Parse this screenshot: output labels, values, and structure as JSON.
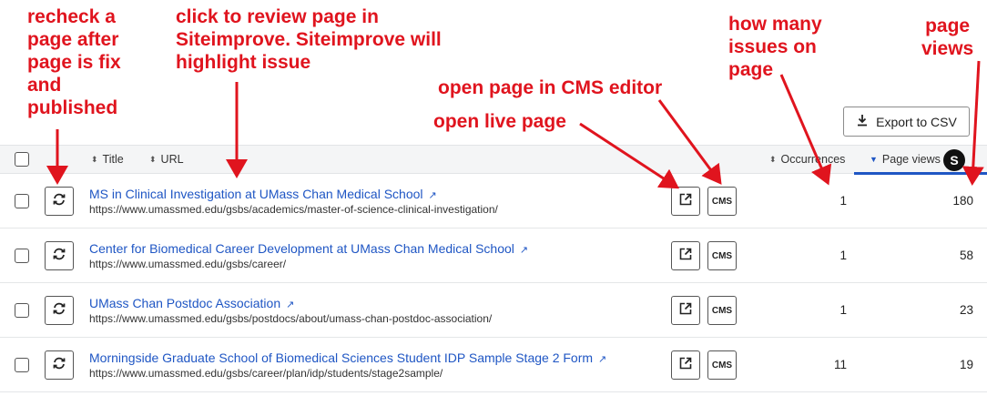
{
  "annotations": {
    "recheck": [
      "recheck a",
      "page after",
      "page is fix",
      "and",
      "published"
    ],
    "review": [
      "click to review page in",
      "Siteimprove. Siteimprove will",
      "highlight issue"
    ],
    "cms": "open page in CMS editor",
    "live": "open live page",
    "issues": [
      "how many",
      "issues on",
      "page"
    ],
    "views": [
      "page",
      "views"
    ]
  },
  "toolbar": {
    "export_label": "Export to CSV"
  },
  "table": {
    "headers": {
      "title": "Title",
      "url": "URL",
      "occurrences": "Occurrences",
      "page_views": "Page views"
    },
    "badge": "S",
    "cms_label": "CMS",
    "rows": [
      {
        "title": "MS in Clinical Investigation at UMass Chan Medical School",
        "url": "https://www.umassmed.edu/gsbs/academics/master-of-science-clinical-investigation/",
        "occurrences": "1",
        "page_views": "180"
      },
      {
        "title": "Center for Biomedical Career Development at UMass Chan Medical School",
        "url": "https://www.umassmed.edu/gsbs/career/",
        "occurrences": "1",
        "page_views": "58"
      },
      {
        "title": "UMass Chan Postdoc Association",
        "url": "https://www.umassmed.edu/gsbs/postdocs/about/umass-chan-postdoc-association/",
        "occurrences": "1",
        "page_views": "23"
      },
      {
        "title": "Morningside Graduate School of Biomedical Sciences Student IDP Sample Stage 2 Form",
        "url": "https://www.umassmed.edu/gsbs/career/plan/idp/students/stage2sample/",
        "occurrences": "11",
        "page_views": "19"
      }
    ]
  },
  "colors": {
    "annotation": "#e0141e",
    "link": "#1f56c4",
    "header_bg": "#f4f5f6"
  }
}
